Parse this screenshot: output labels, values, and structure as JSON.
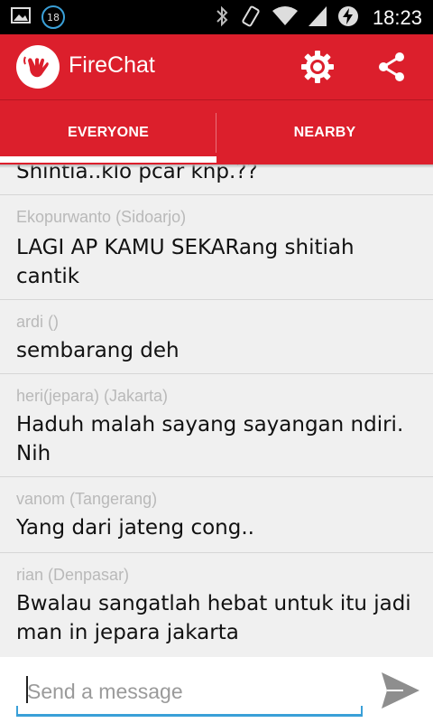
{
  "status_bar": {
    "notification_count": "18",
    "time": "18:23",
    "icons": [
      "image-icon",
      "bluetooth-icon",
      "vibrate-icon",
      "wifi-icon",
      "signal-icon",
      "battery-charging-icon"
    ]
  },
  "app_bar": {
    "title": "FireChat",
    "logo_icon": "firechat-hand-logo",
    "actions": [
      "settings-gear-icon",
      "share-icon"
    ]
  },
  "tabs": [
    {
      "label": "EVERYONE",
      "selected": true
    },
    {
      "label": "NEARBY",
      "selected": false
    }
  ],
  "messages": [
    {
      "sender": "",
      "text": "Shintia..klo pcar knp.??"
    },
    {
      "sender": "Ekopurwanto (Sidoarjo)",
      "text": "LAGI AP KAMU SEKARang shitiah cantik"
    },
    {
      "sender": "ardi ()",
      "text": "sembarang deh"
    },
    {
      "sender": "heri(jepara) (Jakarta)",
      "text": "Haduh malah sayang sayangan ndiri.  Nih"
    },
    {
      "sender": "vanom (Tangerang)",
      "text": "Yang dari jateng cong.."
    },
    {
      "sender": "rian  (Denpasar)",
      "text": "Bwalau sangatlah hebat untuk itu jadi man in jepara jakarta"
    }
  ],
  "composer": {
    "placeholder": "Send a message",
    "value": "",
    "send_icon": "send-icon"
  },
  "colors": {
    "brand_red": "#dc1f2c",
    "input_accent": "#3aa0d8",
    "sender_gray": "#b9b9b9"
  }
}
